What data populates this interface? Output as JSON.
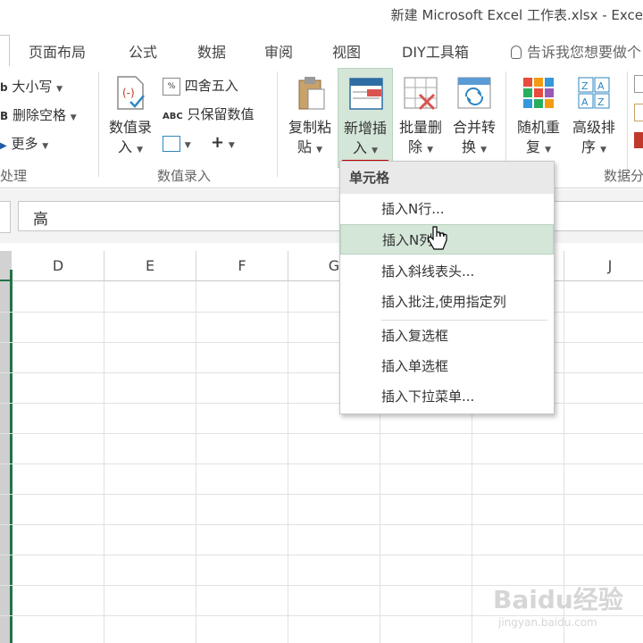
{
  "window": {
    "title": "新建 Microsoft Excel 工作表.xlsx - Exce"
  },
  "tabs": [
    "页面布局",
    "公式",
    "数据",
    "审阅",
    "视图",
    "DIY工具箱"
  ],
  "tell_me": "告诉我您想要做个",
  "ribbon": {
    "left_group": {
      "item1": "大小写",
      "item2": "删除空格",
      "item3": "更多",
      "label": "处理"
    },
    "numeric_group": {
      "btn_line1": "数值录",
      "btn_line2": "入",
      "round": "四舍五入",
      "keep_numeric": "只保留数值",
      "label": "数值录入"
    },
    "copy_paste": {
      "line1": "复制粘",
      "line2": "贴"
    },
    "new_insert": {
      "line1": "新增插",
      "line2": "入"
    },
    "batch_delete": {
      "line1": "批量删",
      "line2": "除"
    },
    "merge_convert": {
      "line1": "合并转",
      "line2": "换"
    },
    "random_repeat": {
      "line1": "随机重",
      "line2": "复"
    },
    "advanced_sort": {
      "line1": "高级排",
      "line2": "序"
    },
    "right_label": "数据分"
  },
  "formula_bar": {
    "value": "高"
  },
  "columns": [
    "D",
    "E",
    "F",
    "G",
    "",
    "J"
  ],
  "menu": {
    "header": "单元格",
    "items": [
      "插入N行...",
      "插入N列...",
      "插入斜线表头...",
      "插入批注,使用指定列",
      "插入复选框",
      "插入单选框",
      "插入下拉菜单..."
    ]
  },
  "watermark": {
    "brand": "Baidu经验",
    "url": "jingyan.baidu.com"
  },
  "colors": {
    "accent_green": "#217346",
    "highlight": "#d4e6d8",
    "underline_red": "#c00000"
  }
}
